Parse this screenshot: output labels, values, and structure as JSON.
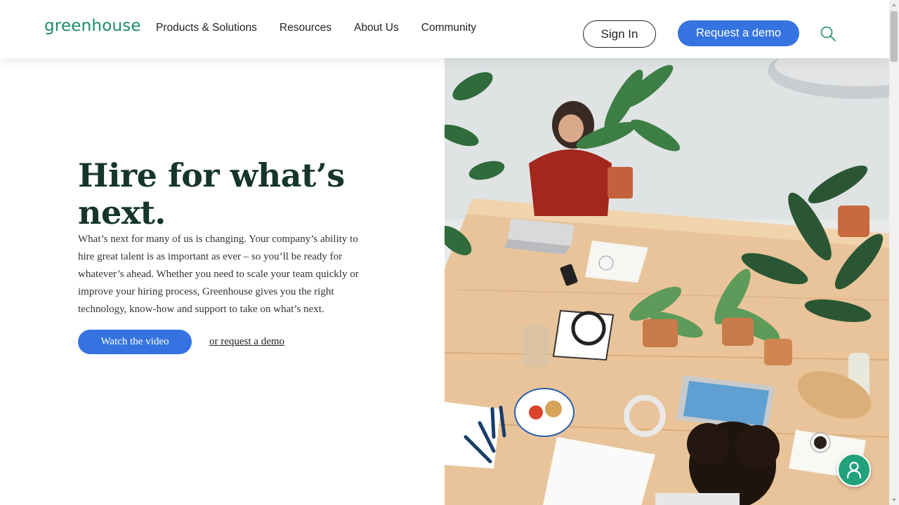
{
  "header": {
    "logo": "greenhouse",
    "nav": [
      {
        "label": "Products & Solutions"
      },
      {
        "label": "Resources"
      },
      {
        "label": "About Us"
      },
      {
        "label": "Community"
      }
    ],
    "sign_in": "Sign In",
    "request_demo": "Request a demo",
    "search_icon": "search-icon"
  },
  "hero": {
    "title": "Hire for what’s next.",
    "body": "What’s next for many of us is changing. Your company’s ability to hire great talent is as important as ever – so you’ll be ready for whatever’s ahead. Whether you need to scale your team quickly or improve your hiring process, Greenhouse gives you the right technology, know-how and support to take on what’s next.",
    "watch_video": "Watch the video",
    "request_demo_link": "or request a demo"
  },
  "colors": {
    "brand_green": "#1d8a6b",
    "primary_blue": "#3574e0",
    "heading": "#15352d",
    "chat": "#22a27b"
  },
  "chat": {
    "icon": "person-icon"
  }
}
